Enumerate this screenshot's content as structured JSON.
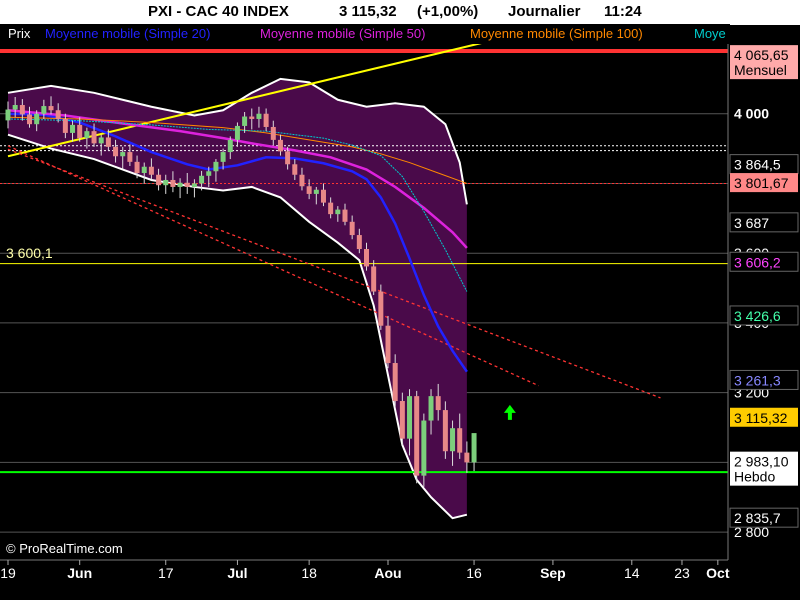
{
  "header": {
    "symbol": "PXI - CAC 40 INDEX",
    "price": "3 115,32",
    "change": "(+1,00%)",
    "period": "Journalier",
    "time": "11:24"
  },
  "legend": [
    {
      "label": "Prix",
      "color": "#ffffff"
    },
    {
      "label": "Moyenne mobile (Simple 20)",
      "color": "#2222ff"
    },
    {
      "label": "Moyenne mobile (Simple 50)",
      "color": "#dd22dd"
    },
    {
      "label": "Moyenne mobile (Simple 100)",
      "color": "#ff8800"
    },
    {
      "label": "Moye",
      "color": "#00cccc"
    }
  ],
  "copyright": "© ProRealTime.com",
  "colors": {
    "background": "#000000",
    "bollinger_fill": "#4a0a4a",
    "candle_up": "#7ccf7c",
    "candle_down": "#e88888",
    "sma20": "#2222ff",
    "sma50": "#dd22dd",
    "sma100": "#ff8800",
    "sma_extra": "#00cccc",
    "trend_yellow": "#ffff00",
    "trend_red": "#ff3333",
    "support_green": "#00ff00"
  },
  "chart_data": {
    "type": "candlestick",
    "y_scale": {
      "min": 2720,
      "max": 4200,
      "grid_levels": [
        4000,
        3800,
        3600,
        3400,
        3200,
        3000,
        2800
      ]
    },
    "y_tick_labels": [
      {
        "value": 4000,
        "label": "4 000"
      },
      {
        "value": 3600,
        "label": "3 600"
      },
      {
        "value": 3400,
        "label": "3 400"
      },
      {
        "value": 3200,
        "label": "3 200"
      },
      {
        "value": 2800,
        "label": "2 800"
      }
    ],
    "x_tick_labels": [
      {
        "day": 0,
        "label": "19",
        "bold": false
      },
      {
        "day": 10,
        "label": "Jun",
        "bold": true
      },
      {
        "day": 22,
        "label": "17",
        "bold": false
      },
      {
        "day": 32,
        "label": "Jul",
        "bold": true
      },
      {
        "day": 42,
        "label": "18",
        "bold": false
      },
      {
        "day": 53,
        "label": "Aou",
        "bold": true
      },
      {
        "day": 65,
        "label": "16",
        "bold": false
      },
      {
        "day": 76,
        "label": "Sep",
        "bold": true
      },
      {
        "day": 87,
        "label": "14",
        "bold": false
      },
      {
        "day": 94,
        "label": "23",
        "bold": false
      },
      {
        "day": 99,
        "label": "Oct",
        "bold": true
      }
    ],
    "candles": [
      [
        3981,
        4035,
        3958,
        4012
      ],
      [
        4012,
        4048,
        3990,
        4025
      ],
      [
        4025,
        4042,
        3980,
        3998
      ],
      [
        3998,
        4020,
        3960,
        3970
      ],
      [
        3970,
        4010,
        3950,
        4000
      ],
      [
        4000,
        4040,
        3985,
        4022
      ],
      [
        4022,
        4050,
        3998,
        4010
      ],
      [
        4010,
        4030,
        3975,
        3985
      ],
      [
        3985,
        4000,
        3930,
        3945
      ],
      [
        3945,
        3980,
        3920,
        3968
      ],
      [
        3968,
        3990,
        3920,
        3930
      ],
      [
        3930,
        3960,
        3900,
        3950
      ],
      [
        3950,
        3972,
        3905,
        3915
      ],
      [
        3915,
        3940,
        3880,
        3932
      ],
      [
        3932,
        3955,
        3895,
        3905
      ],
      [
        3905,
        3925,
        3860,
        3878
      ],
      [
        3878,
        3905,
        3842,
        3890
      ],
      [
        3890,
        3912,
        3850,
        3862
      ],
      [
        3862,
        3880,
        3815,
        3830
      ],
      [
        3830,
        3860,
        3800,
        3848
      ],
      [
        3848,
        3872,
        3812,
        3825
      ],
      [
        3825,
        3842,
        3780,
        3795
      ],
      [
        3795,
        3825,
        3770,
        3810
      ],
      [
        3810,
        3835,
        3775,
        3790
      ],
      [
        3790,
        3815,
        3758,
        3802
      ],
      [
        3802,
        3830,
        3770,
        3790
      ],
      [
        3790,
        3812,
        3760,
        3800
      ],
      [
        3800,
        3836,
        3780,
        3822
      ],
      [
        3822,
        3848,
        3790,
        3835
      ],
      [
        3835,
        3870,
        3805,
        3862
      ],
      [
        3862,
        3900,
        3840,
        3890
      ],
      [
        3890,
        3935,
        3870,
        3925
      ],
      [
        3925,
        3975,
        3905,
        3965
      ],
      [
        3965,
        4005,
        3945,
        3992
      ],
      [
        3992,
        4015,
        3955,
        3985
      ],
      [
        3985,
        4020,
        3960,
        4000
      ],
      [
        4000,
        4015,
        3950,
        3962
      ],
      [
        3962,
        3980,
        3910,
        3925
      ],
      [
        3925,
        3940,
        3880,
        3892
      ],
      [
        3892,
        3905,
        3840,
        3855
      ],
      [
        3855,
        3870,
        3810,
        3825
      ],
      [
        3825,
        3845,
        3780,
        3792
      ],
      [
        3792,
        3812,
        3755,
        3770
      ],
      [
        3770,
        3790,
        3740,
        3782
      ],
      [
        3782,
        3800,
        3735,
        3745
      ],
      [
        3745,
        3760,
        3700,
        3712
      ],
      [
        3712,
        3735,
        3690,
        3725
      ],
      [
        3725,
        3742,
        3680,
        3690
      ],
      [
        3690,
        3708,
        3640,
        3652
      ],
      [
        3652,
        3670,
        3600,
        3612
      ],
      [
        3612,
        3630,
        3550,
        3562
      ],
      [
        3562,
        3580,
        3480,
        3490
      ],
      [
        3490,
        3510,
        3380,
        3392
      ],
      [
        3392,
        3420,
        3270,
        3285
      ],
      [
        3285,
        3310,
        3160,
        3176
      ],
      [
        3176,
        3200,
        3050,
        3068
      ],
      [
        3068,
        3210,
        3020,
        3190
      ],
      [
        3190,
        3205,
        2940,
        2962
      ],
      [
        2962,
        3140,
        2930,
        3120
      ],
      [
        3120,
        3210,
        3080,
        3190
      ],
      [
        3190,
        3225,
        3120,
        3150
      ],
      [
        3150,
        3175,
        3010,
        3032
      ],
      [
        3032,
        3120,
        2990,
        3098
      ],
      [
        3098,
        3140,
        3010,
        3028
      ],
      [
        3028,
        3060,
        2970,
        3000
      ],
      [
        3000,
        3080,
        2975,
        3084
      ]
    ],
    "series": [
      {
        "name": "Moyenne mobile (Simple 20)",
        "key": "sma20",
        "values": [
          [
            0,
            4000
          ],
          [
            5,
            3997
          ],
          [
            10,
            3975
          ],
          [
            15,
            3935
          ],
          [
            20,
            3890
          ],
          [
            25,
            3855
          ],
          [
            28,
            3840
          ],
          [
            32,
            3852
          ],
          [
            36,
            3875
          ],
          [
            40,
            3872
          ],
          [
            44,
            3858
          ],
          [
            48,
            3835
          ],
          [
            50,
            3812
          ],
          [
            52,
            3760
          ],
          [
            54,
            3685
          ],
          [
            56,
            3585
          ],
          [
            58,
            3480
          ],
          [
            60,
            3390
          ],
          [
            62,
            3320
          ],
          [
            64,
            3260
          ]
        ]
      },
      {
        "name": "Moyenne mobile (Simple 50)",
        "key": "sma50",
        "values": [
          [
            0,
            4010
          ],
          [
            8,
            3995
          ],
          [
            16,
            3972
          ],
          [
            24,
            3950
          ],
          [
            30,
            3930
          ],
          [
            34,
            3915
          ],
          [
            40,
            3895
          ],
          [
            45,
            3875
          ],
          [
            50,
            3840
          ],
          [
            54,
            3790
          ],
          [
            58,
            3730
          ],
          [
            62,
            3660
          ],
          [
            64,
            3615
          ]
        ]
      },
      {
        "name": "Moyenne mobile (Simple 100)",
        "key": "sma100",
        "values": [
          [
            0,
            3990
          ],
          [
            10,
            3985
          ],
          [
            20,
            3975
          ],
          [
            30,
            3960
          ],
          [
            36,
            3945
          ],
          [
            42,
            3925
          ],
          [
            48,
            3905
          ],
          [
            52,
            3885
          ],
          [
            56,
            3860
          ],
          [
            60,
            3830
          ],
          [
            64,
            3800
          ]
        ]
      },
      {
        "name": "Moye",
        "key": "sma_extra",
        "values": [
          [
            0,
            3985
          ],
          [
            10,
            3980
          ],
          [
            20,
            3968
          ],
          [
            28,
            3955
          ],
          [
            36,
            3950
          ],
          [
            44,
            3930
          ],
          [
            48,
            3910
          ],
          [
            52,
            3880
          ],
          [
            55,
            3820
          ],
          [
            58,
            3720
          ],
          [
            61,
            3610
          ],
          [
            64,
            3490
          ]
        ]
      }
    ],
    "bollinger": {
      "upper": [
        [
          0,
          4060
        ],
        [
          6,
          4080
        ],
        [
          12,
          4060
        ],
        [
          20,
          4020
        ],
        [
          26,
          3995
        ],
        [
          30,
          4010
        ],
        [
          34,
          4060
        ],
        [
          38,
          4100
        ],
        [
          42,
          4090
        ],
        [
          46,
          4040
        ],
        [
          50,
          4020
        ],
        [
          54,
          4030
        ],
        [
          58,
          4020
        ],
        [
          61,
          3970
        ],
        [
          63,
          3860
        ],
        [
          64,
          3740
        ]
      ],
      "lower": [
        [
          0,
          3940
        ],
        [
          6,
          3900
        ],
        [
          12,
          3870
        ],
        [
          20,
          3810
        ],
        [
          26,
          3790
        ],
        [
          30,
          3780
        ],
        [
          34,
          3790
        ],
        [
          38,
          3760
        ],
        [
          42,
          3690
        ],
        [
          46,
          3630
        ],
        [
          49,
          3580
        ],
        [
          51,
          3450
        ],
        [
          53,
          3250
        ],
        [
          55,
          3050
        ],
        [
          57,
          2950
        ],
        [
          59,
          2900
        ],
        [
          61,
          2860
        ],
        [
          62,
          2840
        ],
        [
          64,
          2850
        ]
      ]
    },
    "trendlines": [
      {
        "name": "resistance",
        "style": "solid",
        "color": "yellow",
        "points": [
          [
            0,
            3878
          ],
          [
            74,
            4242
          ]
        ]
      },
      {
        "name": "channel-upper",
        "style": "dotted",
        "color": "red",
        "points": [
          [
            0,
            3908
          ],
          [
            74,
            3220
          ]
        ]
      },
      {
        "name": "channel-lower",
        "style": "dotted",
        "color": "red",
        "points": [
          [
            0,
            3898
          ],
          [
            91,
            3185
          ]
        ]
      }
    ],
    "horizontal_lines": [
      {
        "value": 4180,
        "color": "red",
        "style": "solid",
        "width": 4
      },
      {
        "value": 3908,
        "color": "white",
        "style": "dotted",
        "width": 1
      },
      {
        "value": 3894,
        "color": "white",
        "style": "dotted",
        "width": 1
      },
      {
        "value": 3800,
        "color": "red",
        "style": "dotted",
        "width": 1
      },
      {
        "value": 3570,
        "color": "yellow",
        "style": "solid",
        "width": 1
      },
      {
        "value": 2972,
        "color": "green",
        "style": "solid",
        "width": 2
      }
    ],
    "line_labels": [
      {
        "value": 3575,
        "label": "3 600,1",
        "color": "#ffffaa"
      }
    ],
    "price_tags": [
      {
        "value": 4148,
        "label": "4 065,65",
        "label2": "Mensuel",
        "bg": "#ffaaaa",
        "fg": "#000000"
      },
      {
        "value": 3854,
        "label": "3 864,5",
        "bg": "#000000",
        "fg": "#ffffff"
      },
      {
        "value": 3801,
        "label": "3 801,67",
        "bg": "#ff8888",
        "fg": "#000000"
      },
      {
        "value": 3687,
        "label": "3 687",
        "bg": "#000000",
        "fg": "#ffffff"
      },
      {
        "value": 3574,
        "label": "3 606,2",
        "bg": "#000000",
        "fg": "#ff44ff"
      },
      {
        "value": 3420,
        "label": "3 426,6",
        "bg": "#000000",
        "fg": "#44ffaa"
      },
      {
        "value": 3235,
        "label": "3 261,3",
        "bg": "#000000",
        "fg": "#8888ff"
      },
      {
        "value": 3128,
        "label": "3 115,32",
        "bg": "#ffcc00",
        "fg": "#000000"
      },
      {
        "value": 2982,
        "label": "2 983,10",
        "label2": "Hebdo",
        "bg": "#ffffff",
        "fg": "#000000"
      },
      {
        "value": 2840,
        "label": "2 835,7",
        "bg": "#000000",
        "fg": "#ffffff"
      }
    ],
    "markers": [
      {
        "type": "up-arrow",
        "day": 70,
        "value": 3142,
        "color": "#00ff00"
      }
    ]
  }
}
